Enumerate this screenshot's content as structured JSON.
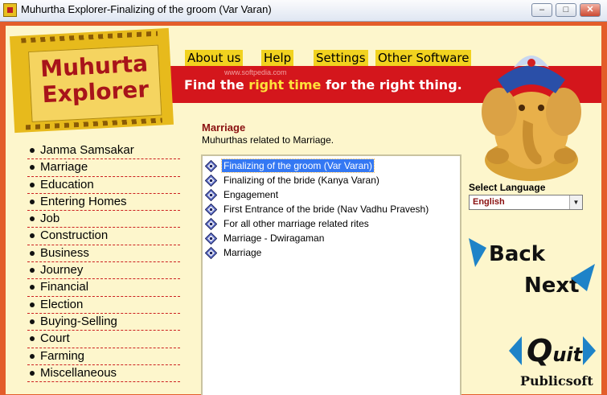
{
  "window": {
    "title": "Muhurtha Explorer-Finalizing of the groom (Var Varan)",
    "controls": {
      "minimize": "–",
      "maximize": "□",
      "close": "✕"
    }
  },
  "banner": {
    "logo_line1": "Muhurta",
    "logo_line2": "Explorer",
    "tagline_part1": "Find the ",
    "tagline_highlight": "right time",
    "tagline_part2": " for the right thing.",
    "watermark": "www.softpedia.com"
  },
  "menu": {
    "about": "About us",
    "help": "Help",
    "settings": "Settings",
    "other": "Other Software"
  },
  "sidebar": {
    "items": [
      {
        "label": "Janma Samsakar"
      },
      {
        "label": "Marriage"
      },
      {
        "label": "Education"
      },
      {
        "label": "Entering Homes"
      },
      {
        "label": "Job"
      },
      {
        "label": "Construction"
      },
      {
        "label": "Business"
      },
      {
        "label": "Journey"
      },
      {
        "label": "Financial"
      },
      {
        "label": "Election"
      },
      {
        "label": "Buying-Selling"
      },
      {
        "label": "Court"
      },
      {
        "label": "Farming"
      },
      {
        "label": "Miscellaneous"
      }
    ]
  },
  "main": {
    "title": "Marriage",
    "description": "Muhurthas related to Marriage.",
    "items": [
      {
        "label": "Finalizing of the groom (Var Varan)"
      },
      {
        "label": "Finalizing of the bride (Kanya Varan)"
      },
      {
        "label": "Engagement"
      },
      {
        "label": "First Entrance of the bride (Nav Vadhu Pravesh)"
      },
      {
        "label": "For all other marriage related rites"
      },
      {
        "label": "Marriage - Dwiragaman"
      },
      {
        "label": "Marriage"
      }
    ]
  },
  "language": {
    "label": "Select Language",
    "selected": "English"
  },
  "nav": {
    "back": "Back",
    "next": "Next",
    "quit_q": "Q",
    "quit_rest": "uit"
  },
  "footer": {
    "publisher": "Publicsoft"
  },
  "colors": {
    "frame": "#e35d2a",
    "panel": "#fdf6cc",
    "banner_red": "#d4161c",
    "menu_bg": "#f1d21f",
    "arrow": "#1e83c8",
    "selection": "#3478f3"
  }
}
